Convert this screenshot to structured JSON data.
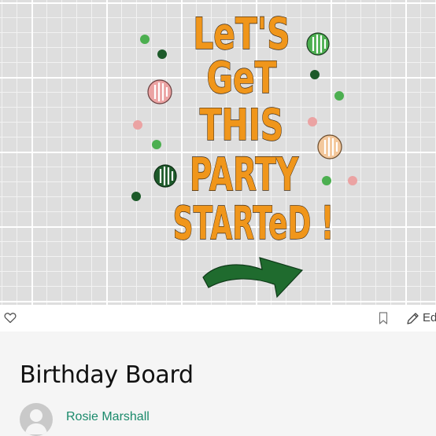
{
  "design": {
    "headline_lines": [
      "LeT'S",
      "GeT",
      "THIS",
      "PARTY",
      "STARTeD !"
    ],
    "colors": {
      "lettering": "#f0961b",
      "outline": "#3a2a1a",
      "arrow": "#1f6b2e",
      "dark_green": "#1d5a2a",
      "light_green": "#4caf50",
      "pink": "#eba3a3",
      "peach": "#f3c79b"
    }
  },
  "actions": {
    "like_icon": "heart-outline-icon",
    "save_icon": "bookmark-outline-icon",
    "edit_icon": "pencil-icon",
    "edit_label": "Ed"
  },
  "project": {
    "title": "Birthday Board",
    "author": "Rosie Marshall"
  }
}
